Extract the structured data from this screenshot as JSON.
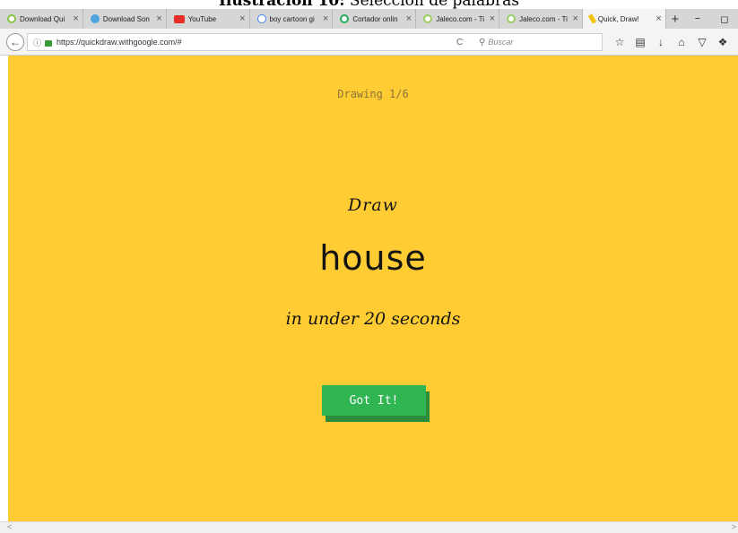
{
  "document_caption": {
    "bold": "Ilustración 10:",
    "text": " Selección de palabras"
  },
  "browser": {
    "tabs": [
      {
        "label": "Download Qui",
        "icon": "quiz-favicon-icon",
        "active": false
      },
      {
        "label": "Download Son",
        "icon": "softonic-favicon-icon",
        "active": false
      },
      {
        "label": "YouTube",
        "icon": "youtube-favicon-icon",
        "active": false
      },
      {
        "label": "boy cartoon gi",
        "icon": "google-favicon-icon",
        "active": false
      },
      {
        "label": "Cortador onlin",
        "icon": "cortador-favicon-icon",
        "active": false
      },
      {
        "label": "Jaleco.com - Ti",
        "icon": "jaleco-favicon-icon",
        "active": false
      },
      {
        "label": "Jaleco.com - Ti",
        "icon": "jaleco-favicon-icon",
        "active": false
      },
      {
        "label": "Quick, Draw!",
        "icon": "quickdraw-favicon-icon",
        "active": true
      }
    ],
    "new_tab": "+",
    "window_controls": {
      "minimize": "−",
      "maximize": "◻"
    },
    "url": "https://quickdraw.withgoogle.com/#",
    "search_placeholder": "Buscar",
    "toolbar_icons": [
      "star-icon",
      "reading-list-icon",
      "download-icon",
      "home-icon",
      "pocket-icon",
      "screenshot-icon"
    ]
  },
  "page": {
    "round": "Drawing 1/6",
    "prompt": "Draw",
    "target_word": "house",
    "time_limit": "in under 20 seconds",
    "button": "Got It!"
  },
  "colors": {
    "page_background": "#ffcd33",
    "button": "#2fb551",
    "button_shadow": "#2c8c3c"
  }
}
